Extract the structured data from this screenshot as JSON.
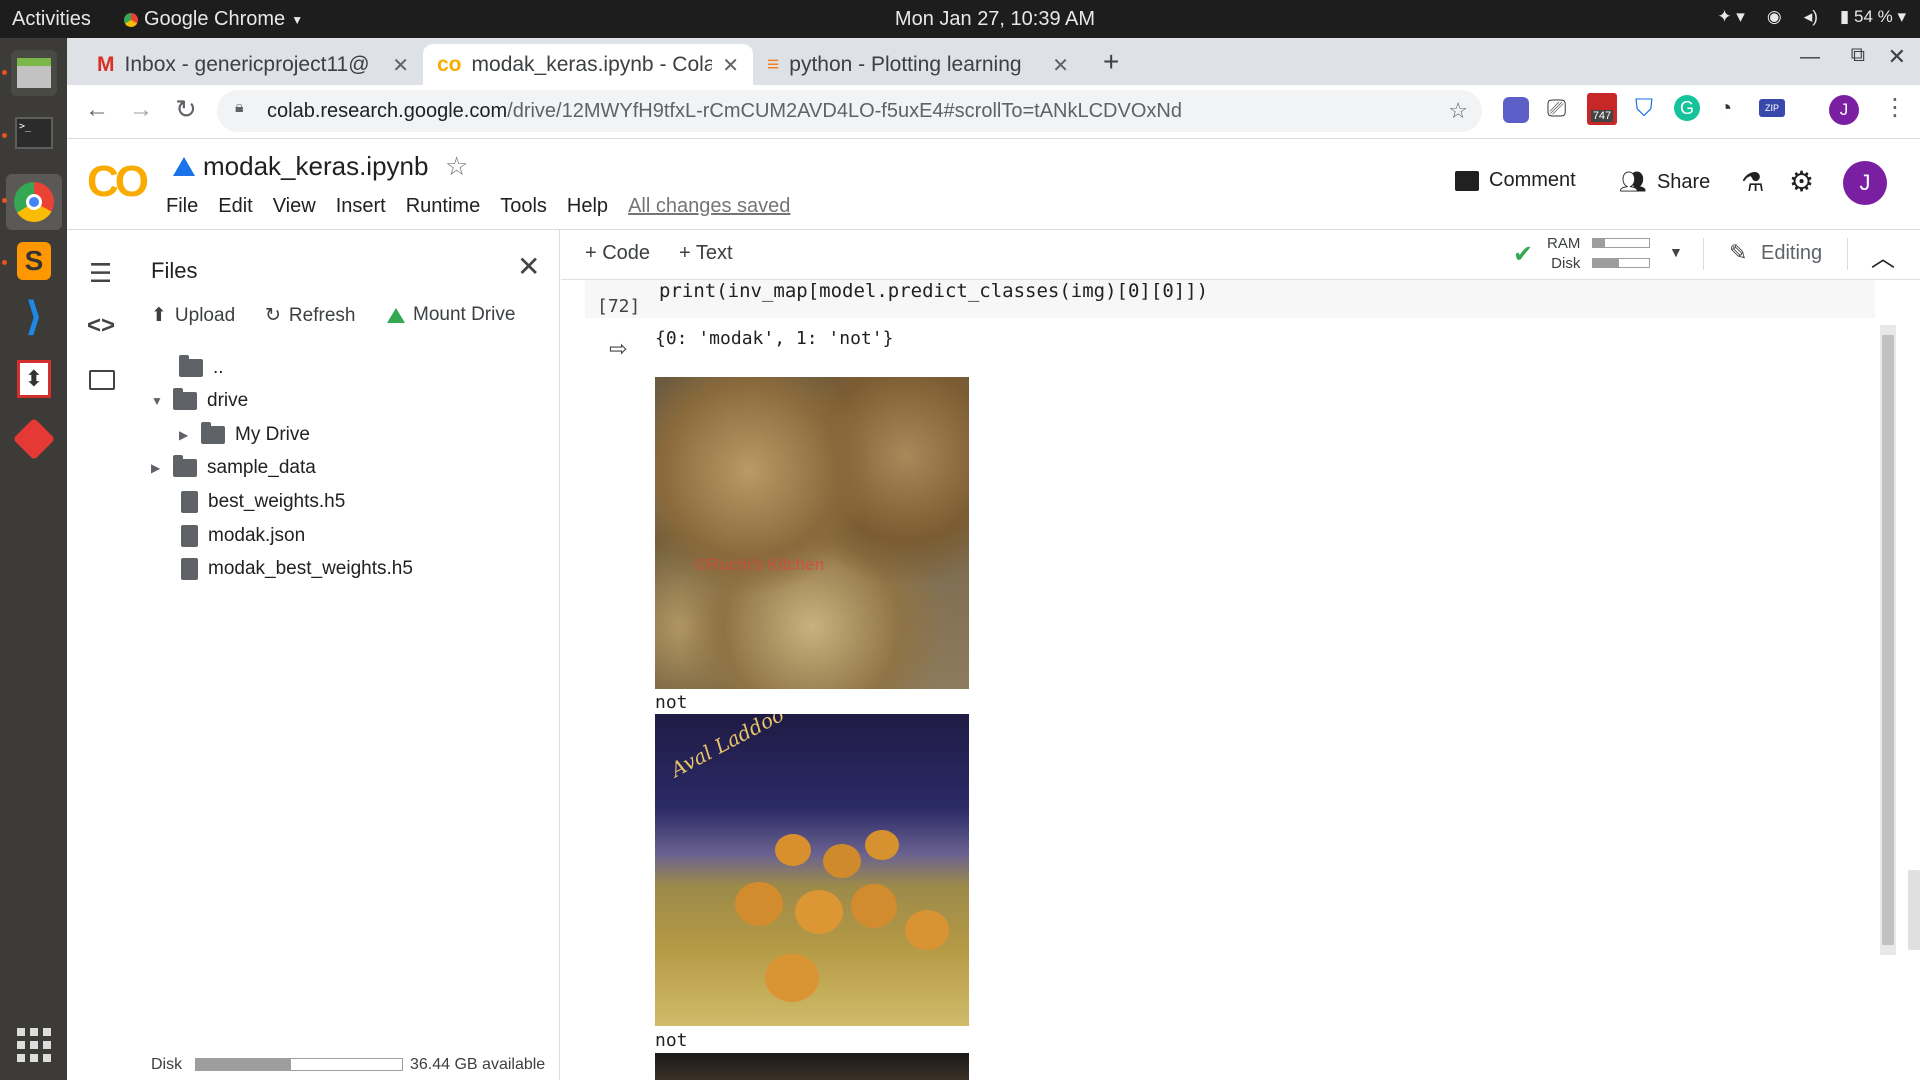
{
  "system": {
    "activities": "Activities",
    "app_name": "Google Chrome",
    "clock": "Mon Jan 27, 10:39 AM",
    "battery": "54 %"
  },
  "browser": {
    "tabs": [
      {
        "label": "Inbox - genericproject11@"
      },
      {
        "label": "modak_keras.ipynb - Colab"
      },
      {
        "label": "python - Plotting learning"
      }
    ],
    "url_host": "colab.research.google.com",
    "url_path": "/drive/12MWYfH9tfxL-rCmCUM2AVD4LO-f5uxE4#scrollTo=tANkLCDVOxNd",
    "ext_badge": "747",
    "profile_initial": "J"
  },
  "colab": {
    "logo": "CO",
    "notebook_title": "modak_keras.ipynb",
    "menu": [
      "File",
      "Edit",
      "View",
      "Insert",
      "Runtime",
      "Tools",
      "Help"
    ],
    "saved_status": "All changes saved",
    "comment_label": "Comment",
    "share_label": "Share",
    "avatar_initial": "J",
    "toolbar": {
      "code_label": "+ Code",
      "text_label": "+ Text",
      "ram_label": "RAM",
      "disk_label": "Disk",
      "editing_label": "Editing"
    }
  },
  "files_panel": {
    "title": "Files",
    "upload_label": "Upload",
    "refresh_label": "Refresh",
    "mount_label": "Mount Drive",
    "tree": [
      "..",
      "drive",
      "My Drive",
      "sample_data",
      "best_weights.h5",
      "modak.json",
      "modak_best_weights.h5"
    ],
    "disk_label": "Disk",
    "disk_available": "36.44 GB available"
  },
  "cell": {
    "exec_count": "[72]",
    "code_line": "print(inv_map[model.predict_classes(img)[0][0]])",
    "output_dict": "{0: 'modak', 1: 'not'}",
    "prediction_1": "not",
    "prediction_2": "not",
    "image_watermark": "©Ruchi's Kitchen",
    "image2_caption": "Aval Laddoo"
  }
}
